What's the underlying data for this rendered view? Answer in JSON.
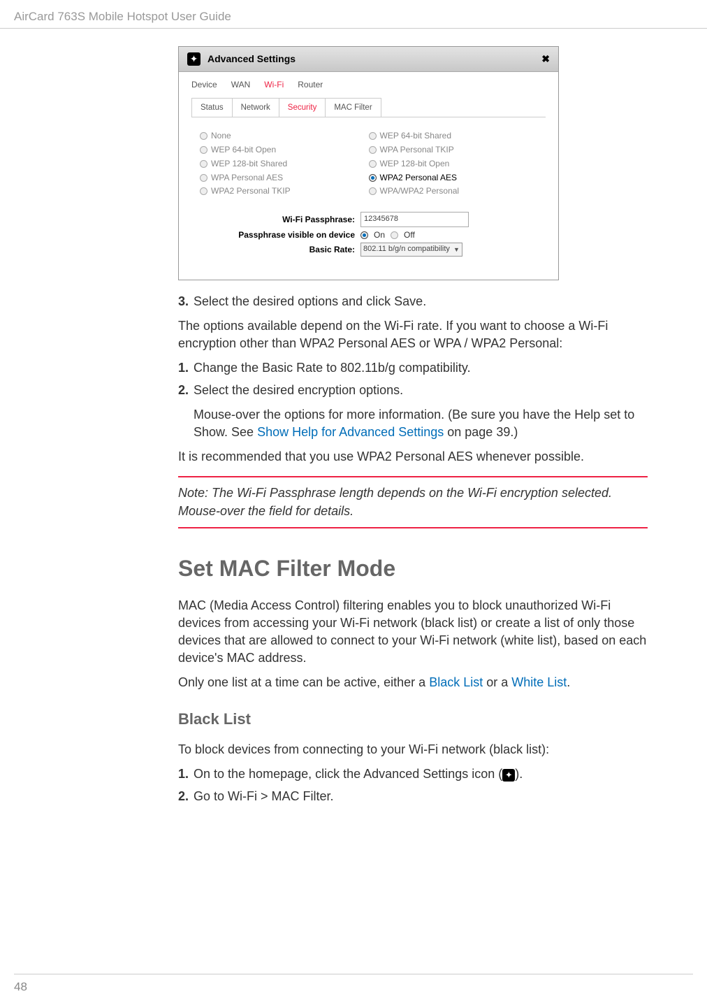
{
  "header": {
    "title": "AirCard 763S Mobile Hotspot User Guide"
  },
  "footer": {
    "page_number": "48"
  },
  "screenshot": {
    "title": "Advanced Settings",
    "close": "✖",
    "tabs": [
      "Device",
      "WAN",
      "Wi-Fi",
      "Router"
    ],
    "active_tab": "Wi-Fi",
    "subtabs": [
      "Status",
      "Network",
      "Security",
      "MAC Filter"
    ],
    "active_subtab": "Security",
    "left_options": [
      "None",
      "WEP 64-bit Open",
      "WEP 128-bit Shared",
      "WPA Personal AES",
      "WPA2 Personal TKIP"
    ],
    "right_options": [
      "WEP 64-bit Shared",
      "WPA Personal TKIP",
      "WEP 128-bit Open",
      "WPA2 Personal AES",
      "WPA/WPA2 Personal"
    ],
    "selected_option": "WPA2 Personal AES",
    "form": {
      "passphrase_label": "Wi-Fi Passphrase:",
      "passphrase_value": "12345678",
      "visibility_label": "Passphrase visible on device",
      "on_label": "On",
      "off_label": "Off",
      "visibility_value": "On",
      "basic_rate_label": "Basic Rate:",
      "basic_rate_value": "802.11 b/g/n compatibility"
    }
  },
  "steps_before": {
    "step3_num": "3.",
    "step3_text": "Select the desired options and click Save."
  },
  "para1": "The options available depend on the Wi-Fi rate. If you want to choose a Wi-Fi encryption other than WPA2 Personal AES or WPA / WPA2 Personal:",
  "steps_middle": {
    "step1_num": "1.",
    "step1_text": "Change the Basic Rate to 802.11b/g compatibility.",
    "step2_num": "2.",
    "step2_text": "Select the desired encryption options.",
    "step2_extra_a": "Mouse-over the options for more information. (Be sure you have the Help set to Show. See ",
    "step2_link": "Show Help for Advanced Settings",
    "step2_extra_b": " on page 39.)"
  },
  "para2": "It is recommended that you use WPA2 Personal AES whenever possible.",
  "note": {
    "label": "Note: ",
    "text": "The Wi-Fi Passphrase length depends on the Wi-Fi encryption selected. Mouse-over the field for details."
  },
  "section_heading": "Set MAC Filter Mode",
  "mac_para1": "MAC (Media Access Control) filtering enables you to block unauthorized Wi-Fi devices from accessing your Wi-Fi network (black list) or create a list of only those devices that are allowed to connect to your Wi-Fi network (white list), based on each device's MAC address.",
  "mac_para2_a": "Only one list at a time can be active, either a ",
  "mac_para2_link1": "Black List",
  "mac_para2_b": " or a ",
  "mac_para2_link2": "White List",
  "mac_para2_c": ".",
  "subsection_heading": "Black List",
  "black_para1": "To block devices from connecting to your Wi-Fi network (black list):",
  "black_steps": {
    "step1_num": "1.",
    "step1_a": "On to the homepage, click the Advanced Settings icon (",
    "step1_b": ").",
    "step2_num": "2.",
    "step2_text": "Go to Wi-Fi > MAC Filter."
  }
}
